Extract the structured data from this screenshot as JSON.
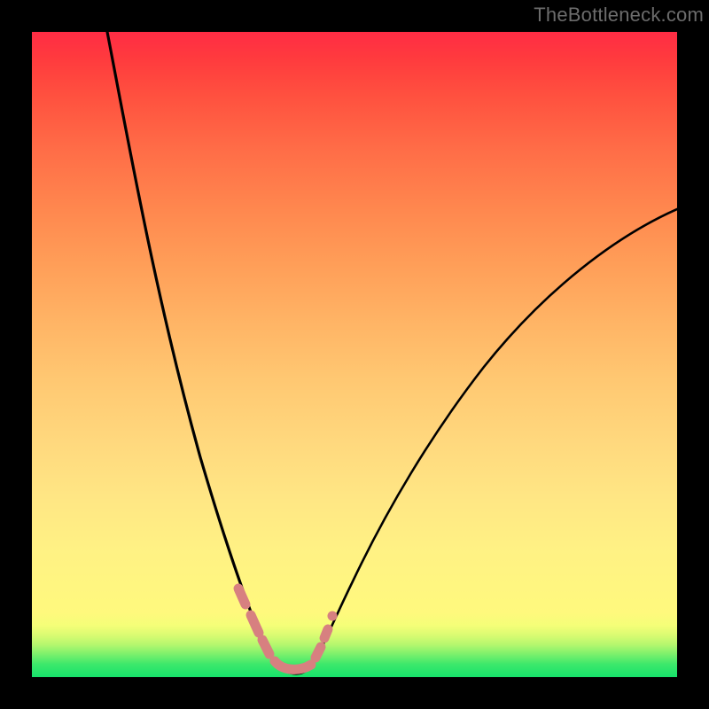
{
  "watermark": {
    "text": "TheBottleneck.com"
  },
  "colors": {
    "frame": "#000000",
    "overlay_accent": "#d78080",
    "curve": "#000000",
    "gradient_stops": [
      "#16e26b",
      "#3de86b",
      "#7af06c",
      "#b4f76e",
      "#d9fb72",
      "#f5fe78",
      "#fff97d",
      "#fff680",
      "#fff184",
      "#ffe684",
      "#ffd97e",
      "#ffc872",
      "#ffb465",
      "#ff9e58",
      "#ff864e",
      "#ff6c47",
      "#ff513f",
      "#ff3a3e",
      "#ff2c44"
    ]
  },
  "chart_data": {
    "type": "line",
    "title": "",
    "xlabel": "",
    "ylabel": "",
    "xlim": [
      0,
      100
    ],
    "ylim": [
      0,
      100
    ],
    "series": [
      {
        "name": "left-curve",
        "x": [
          12,
          14,
          16,
          18,
          20,
          22,
          24,
          26,
          28,
          30,
          32,
          33,
          34,
          35,
          36,
          37
        ],
        "y": [
          100,
          93,
          86,
          79,
          72,
          65,
          57,
          49,
          41,
          33,
          24,
          19,
          14,
          9,
          5,
          2
        ]
      },
      {
        "name": "valley-floor",
        "x": [
          37,
          38,
          39,
          40,
          41,
          42,
          43
        ],
        "y": [
          2,
          1,
          0.5,
          0.5,
          0.5,
          1,
          2
        ]
      },
      {
        "name": "right-curve",
        "x": [
          43,
          44,
          46,
          48,
          51,
          55,
          60,
          66,
          73,
          80,
          88,
          96,
          100
        ],
        "y": [
          2,
          4,
          8,
          12,
          17,
          23,
          30,
          37,
          45,
          52,
          59,
          66,
          69
        ]
      }
    ],
    "overlay_segments": {
      "name": "bottleneck-highlight",
      "color": "#d78080",
      "points_x": [
        32,
        33.5,
        35,
        36.5,
        38,
        40,
        42,
        43.5,
        44.5,
        45.5
      ],
      "points_y": [
        14,
        11,
        8,
        5,
        2.5,
        1.5,
        2.5,
        5,
        8,
        11
      ]
    },
    "annotations": [
      {
        "text": "TheBottleneck.com",
        "position": "top-right",
        "role": "watermark"
      }
    ]
  }
}
